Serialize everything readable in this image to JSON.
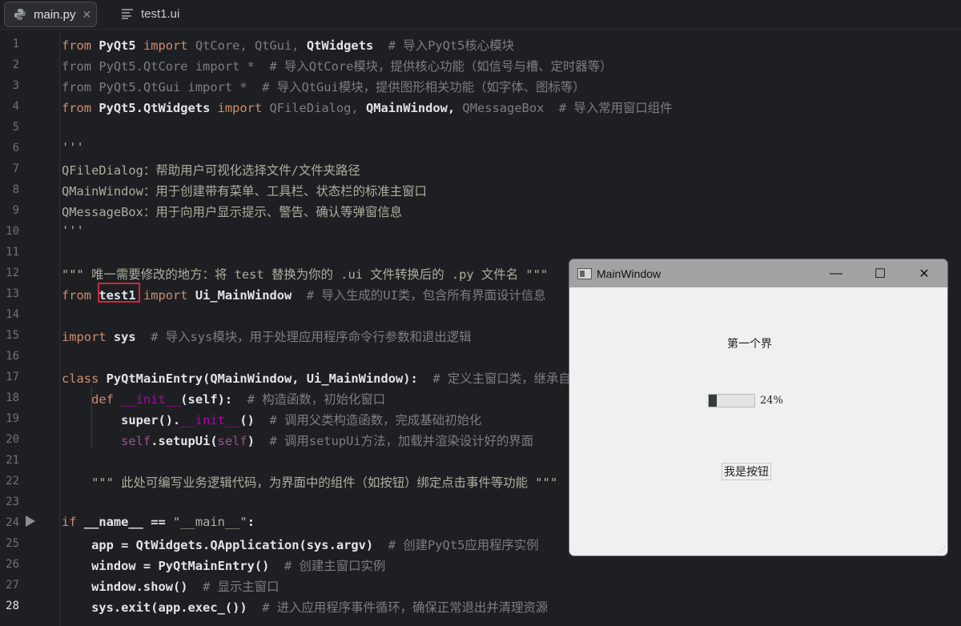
{
  "tabs": [
    {
      "label": "main.py",
      "icon": "python-icon",
      "active": true
    },
    {
      "label": "test1.ui",
      "icon": "ui-file-icon",
      "active": false
    }
  ],
  "close_glyph": "✕",
  "current_line": 28,
  "highlight_word": "test1",
  "code_lines": [
    [
      [
        "from ",
        "k"
      ],
      [
        "PyQt5 ",
        "n"
      ],
      [
        "import ",
        "k"
      ],
      [
        "QtCore, QtGui, ",
        "d"
      ],
      [
        "QtWidgets ",
        "n"
      ],
      [
        " # 导入PyQt5核心模块",
        "c"
      ]
    ],
    [
      [
        "from PyQt5.QtCore import *  ",
        "d"
      ],
      [
        "# 导入QtCore模块，提供核心功能（如信号与槽、定时器等）",
        "c"
      ]
    ],
    [
      [
        "from PyQt5.QtGui import *  ",
        "d"
      ],
      [
        "# 导入QtGui模块，提供图形相关功能（如字体、图标等）",
        "c"
      ]
    ],
    [
      [
        "from ",
        "k"
      ],
      [
        "PyQt5.QtWidgets ",
        "n"
      ],
      [
        "import ",
        "k"
      ],
      [
        "QFileDialog, ",
        "d"
      ],
      [
        "QMainWindow, ",
        "n"
      ],
      [
        "QMessageBox  ",
        "d"
      ],
      [
        "# 导入常用窗口组件",
        "c"
      ]
    ],
    [],
    [
      [
        "'''",
        "s"
      ]
    ],
    [
      [
        "QFileDialog：帮助用户可视化选择文件/文件夹路径",
        "s"
      ]
    ],
    [
      [
        "QMainWindow：用于创建带有菜单、工具栏、状态栏的标准主窗口",
        "s"
      ]
    ],
    [
      [
        "QMessageBox：用于向用户显示提示、警告、确认等弹窗信息",
        "s"
      ]
    ],
    [
      [
        "'''",
        "s"
      ]
    ],
    [],
    [
      [
        "\"\"\" 唯一需要修改的地方：将 test 替换为你的 .ui 文件转换后的 .py 文件名 \"\"\"",
        "s"
      ]
    ],
    [
      [
        "from ",
        "k"
      ],
      [
        "test1 ",
        "n"
      ],
      [
        "import ",
        "k"
      ],
      [
        "Ui_MainWindow  ",
        "n"
      ],
      [
        "# 导入生成的UI类，包含所有界面设计信息",
        "c"
      ]
    ],
    [],
    [
      [
        "import ",
        "k"
      ],
      [
        "sys  ",
        "n"
      ],
      [
        "# 导入sys模块，用于处理应用程序命令行参数和退出逻辑",
        "c"
      ]
    ],
    [],
    [
      [
        "class ",
        "k"
      ],
      [
        "PyQtMainEntry(QMainWindow, Ui_MainWindow):  ",
        "n"
      ],
      [
        "# 定义主窗口类，继承自",
        "c"
      ]
    ],
    [
      [
        "    def ",
        "k"
      ],
      [
        "__init__",
        "dm"
      ],
      [
        "(self):  ",
        "n"
      ],
      [
        "# 构造函数，初始化窗口",
        "c"
      ]
    ],
    [
      [
        "        super().",
        "n"
      ],
      [
        "__init__",
        "dm"
      ],
      [
        "()  ",
        "n"
      ],
      [
        "# 调用父类构造函数，完成基础初始化",
        "c"
      ]
    ],
    [
      [
        "        self",
        "sf"
      ],
      [
        ".setupUi(",
        "n"
      ],
      [
        "self",
        "sf"
      ],
      [
        ")  ",
        "n"
      ],
      [
        "# 调用setupUi方法，加载并渲染设计好的界面",
        "c"
      ]
    ],
    [],
    [
      [
        "    \"\"\" 此处可编写业务逻辑代码，为界面中的组件（如按钮）绑定点击事件等功能 \"\"\"",
        "s"
      ]
    ],
    [],
    [
      [
        "if ",
        "k"
      ],
      [
        "__name__ == ",
        "n"
      ],
      [
        "\"__main__\"",
        "s"
      ],
      [
        ":",
        "n"
      ]
    ],
    [
      [
        "    app = QtWidgets.QApplication(sys.argv)  ",
        "n"
      ],
      [
        "# 创建PyQt5应用程序实例",
        "c"
      ]
    ],
    [
      [
        "    window = PyQtMainEntry()  ",
        "n"
      ],
      [
        "# 创建主窗口实例",
        "c"
      ]
    ],
    [
      [
        "    window.show()  ",
        "n"
      ],
      [
        "# 显示主窗口",
        "c"
      ]
    ],
    [
      [
        "    sys.exit(app.exec_())  ",
        "n"
      ],
      [
        "# 进入应用程序事件循环，确保正常退出并清理资源",
        "c"
      ]
    ]
  ],
  "window": {
    "title": "MainWindow",
    "minimize": "—",
    "maximize": "☐",
    "close": "✕",
    "label": "第一个界",
    "progress_percent": 24,
    "progress_text": "24%",
    "button": "我是按钮"
  }
}
